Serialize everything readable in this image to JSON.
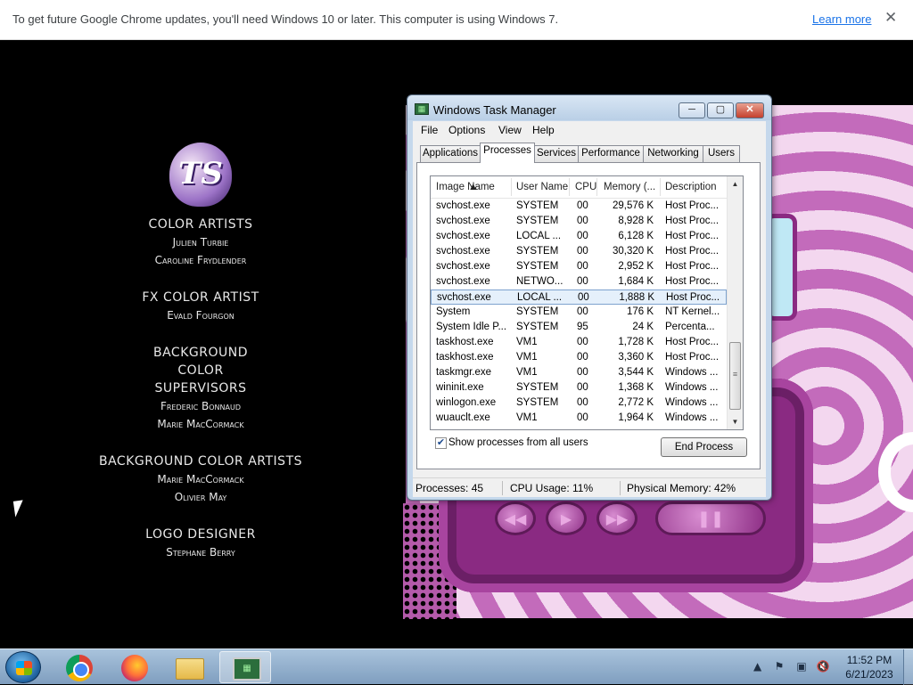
{
  "browser_infobar": {
    "message": "To get future Google Chrome updates, you'll need Windows 10 or later. This computer is using Windows 7.",
    "learn_more": "Learn more",
    "close_glyph": "✕"
  },
  "credits": {
    "logo_text": "TS",
    "groups": [
      {
        "heading": "COLOR ARTISTS",
        "names": [
          "Julien Turbie",
          "Caroline Frydlender"
        ]
      },
      {
        "heading": "FX COLOR ARTIST",
        "names": [
          "Evald Fourgon"
        ]
      },
      {
        "heading": "BACKGROUND COLOR SUPERVISORS",
        "names": [
          "Frederic Bonnaud",
          "Marie MacCormack"
        ]
      },
      {
        "heading": "BACKGROUND COLOR ARTISTS",
        "names": [
          "Marie MacCormack",
          "Olivier May"
        ]
      },
      {
        "heading": "LOGO DESIGNER",
        "names": [
          "Stephane Berry"
        ]
      }
    ]
  },
  "task_manager": {
    "title": "Windows Task Manager",
    "window_buttons": {
      "minimize": "─",
      "maximize": "▢",
      "close": "✕"
    },
    "menu": [
      "File",
      "Options",
      "View",
      "Help"
    ],
    "tabs": [
      "Applications",
      "Processes",
      "Services",
      "Performance",
      "Networking",
      "Users"
    ],
    "active_tab": "Processes",
    "columns": [
      "Image Name",
      "User Name",
      "CPU",
      "Memory (...",
      "Description"
    ],
    "rows": [
      {
        "name": "svchost.exe",
        "user": "SYSTEM",
        "cpu": "00",
        "memory": "29,576 K",
        "desc": "Host Proc..."
      },
      {
        "name": "svchost.exe",
        "user": "SYSTEM",
        "cpu": "00",
        "memory": "8,928 K",
        "desc": "Host Proc..."
      },
      {
        "name": "svchost.exe",
        "user": "LOCAL ...",
        "cpu": "00",
        "memory": "6,128 K",
        "desc": "Host Proc..."
      },
      {
        "name": "svchost.exe",
        "user": "SYSTEM",
        "cpu": "00",
        "memory": "30,320 K",
        "desc": "Host Proc..."
      },
      {
        "name": "svchost.exe",
        "user": "SYSTEM",
        "cpu": "00",
        "memory": "2,952 K",
        "desc": "Host Proc..."
      },
      {
        "name": "svchost.exe",
        "user": "NETWO...",
        "cpu": "00",
        "memory": "1,684 K",
        "desc": "Host Proc..."
      },
      {
        "name": "svchost.exe",
        "user": "LOCAL ...",
        "cpu": "00",
        "memory": "1,888 K",
        "desc": "Host Proc...",
        "selected": true
      },
      {
        "name": "System",
        "user": "SYSTEM",
        "cpu": "00",
        "memory": "176 K",
        "desc": "NT Kernel..."
      },
      {
        "name": "System Idle P...",
        "user": "SYSTEM",
        "cpu": "95",
        "memory": "24 K",
        "desc": "Percenta..."
      },
      {
        "name": "taskhost.exe",
        "user": "VM1",
        "cpu": "00",
        "memory": "1,728 K",
        "desc": "Host Proc..."
      },
      {
        "name": "taskhost.exe",
        "user": "VM1",
        "cpu": "00",
        "memory": "3,360 K",
        "desc": "Host Proc..."
      },
      {
        "name": "taskmgr.exe",
        "user": "VM1",
        "cpu": "00",
        "memory": "3,544 K",
        "desc": "Windows ..."
      },
      {
        "name": "wininit.exe",
        "user": "SYSTEM",
        "cpu": "00",
        "memory": "1,368 K",
        "desc": "Windows ..."
      },
      {
        "name": "winlogon.exe",
        "user": "SYSTEM",
        "cpu": "00",
        "memory": "2,772 K",
        "desc": "Windows ..."
      },
      {
        "name": "wuauclt.exe",
        "user": "VM1",
        "cpu": "00",
        "memory": "1,964 K",
        "desc": "Windows ..."
      }
    ],
    "show_all_users": {
      "label": "Show processes from all users",
      "checked": true,
      "check_glyph": "✔"
    },
    "end_process": "End Process",
    "status": {
      "processes": "Processes: 45",
      "cpu": "CPU Usage: 11%",
      "memory": "Physical Memory: 42%"
    }
  },
  "taskbar": {
    "apps": [
      "start-button",
      "chrome-icon",
      "firefox-icon",
      "file-explorer-icon",
      "task-manager-icon"
    ],
    "tray_arrow": "▲",
    "time": "11:52 PM",
    "date": "6/21/2023"
  }
}
